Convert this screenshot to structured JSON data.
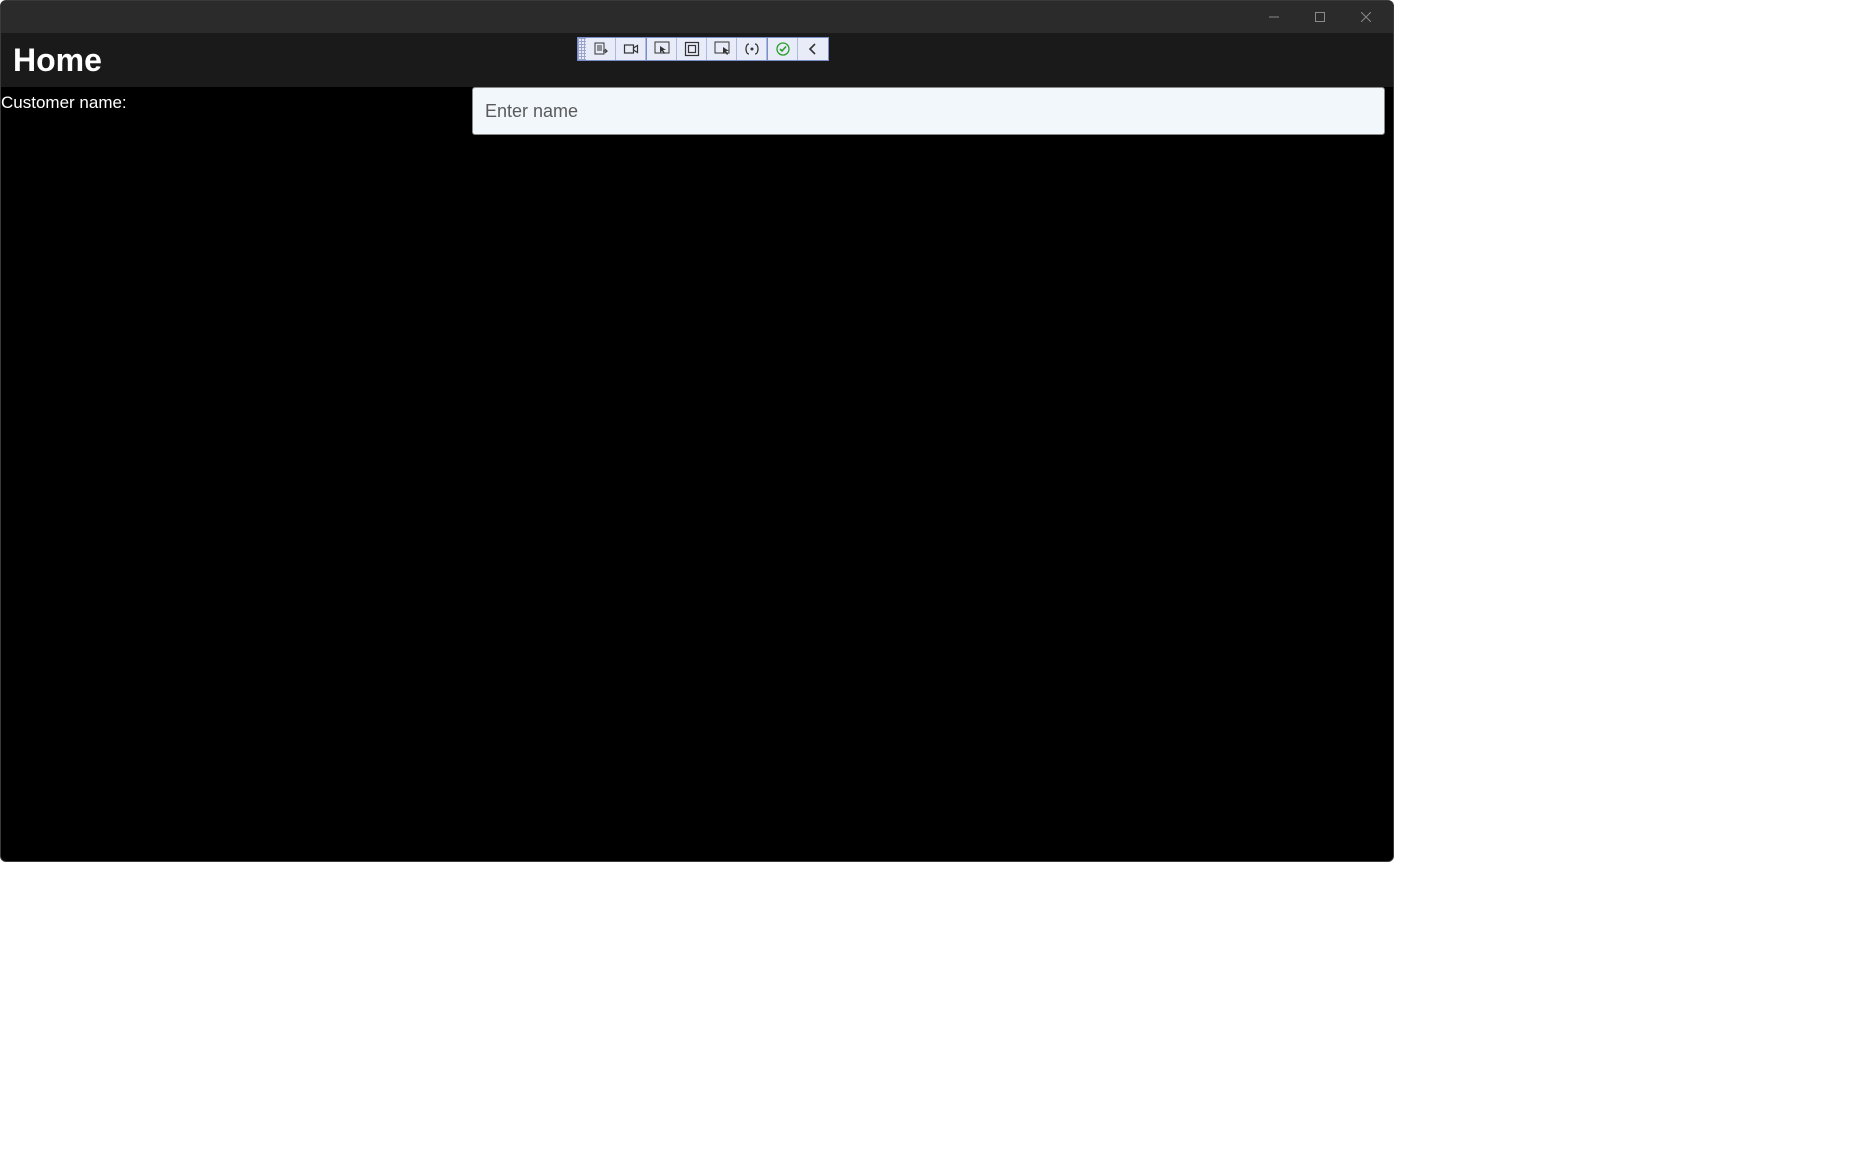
{
  "header": {
    "title": "Home"
  },
  "form": {
    "customer_name_label": "Customer name:",
    "customer_name_placeholder": "Enter name",
    "customer_name_value": ""
  },
  "toolbar": {
    "items": [
      "record-steps-icon",
      "video-icon",
      "pointer-icon",
      "container-icon",
      "target-icon",
      "brackets-icon",
      "checkmark-icon",
      "collapse-icon"
    ]
  },
  "window_controls": {
    "minimize": "minimize",
    "maximize": "maximize",
    "close": "close"
  }
}
